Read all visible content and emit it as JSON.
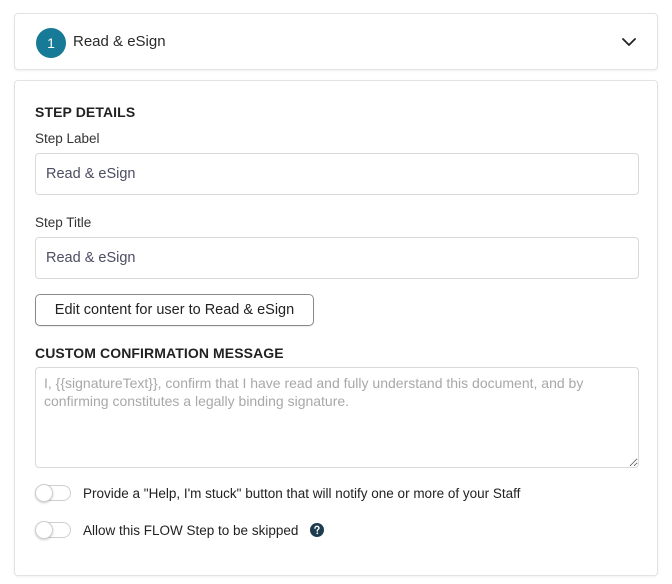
{
  "header": {
    "step_number": "1",
    "step_name": "Read & eSign",
    "expand_icon": "chevron-down-icon"
  },
  "details": {
    "section_title": "STEP DETAILS",
    "step_label": {
      "label": "Step Label",
      "value": "Read & eSign"
    },
    "step_title": {
      "label": "Step Title",
      "value": "Read & eSign"
    },
    "edit_button_label": "Edit content for user to Read & eSign"
  },
  "confirmation": {
    "section_title": "CUSTOM CONFIRMATION MESSAGE",
    "placeholder": "I, {{signatureText}}, confirm that I have read and fully understand this document, and by confirming constitutes a legally binding signature."
  },
  "toggles": [
    {
      "label": "Provide a \"Help, I'm stuck\" button that will notify one or more of your Staff",
      "on": false
    },
    {
      "label": "Allow this FLOW Step to be skipped",
      "on": false,
      "help_icon": "question-circle-icon"
    }
  ],
  "colors": {
    "accent": "#177a96",
    "help_icon": "#1d3c4e"
  }
}
